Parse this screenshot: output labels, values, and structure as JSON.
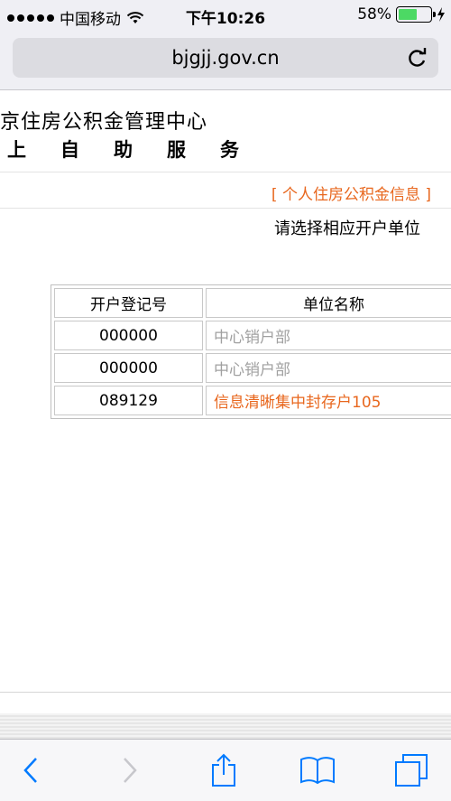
{
  "status_bar": {
    "carrier": "中国移动",
    "time": "下午10:26",
    "battery_percent": "58%",
    "battery_level": 0.58,
    "wifi_icon": "wifi-icon",
    "charging_icon": "charging-bolt-icon"
  },
  "browser": {
    "url": "bjgjj.gov.cn",
    "reload_icon": "reload-icon",
    "reload_glyph": "C"
  },
  "page": {
    "header_title": "京住房公积金管理中心",
    "header_subtitle": "上自助服务",
    "section_title": "[ 个人住房公积金信息 ]",
    "prompt": "请选择相应开户单位",
    "table": {
      "columns": [
        "开户登记号",
        "单位名称"
      ],
      "rows": [
        {
          "reg_no": "000000",
          "unit": "中心销户部"
        },
        {
          "reg_no": "000000",
          "unit": "中心销户部"
        },
        {
          "reg_no": "089129",
          "unit": "信息清晰集中封存户105"
        }
      ]
    }
  },
  "toolbar": {
    "buttons": [
      "back-icon",
      "forward-icon",
      "share-icon",
      "bookmarks-icon",
      "tabs-icon"
    ]
  },
  "colors": {
    "accent": "#e8671e",
    "ios_blue": "#007aff",
    "battery_green": "#4cd964"
  }
}
